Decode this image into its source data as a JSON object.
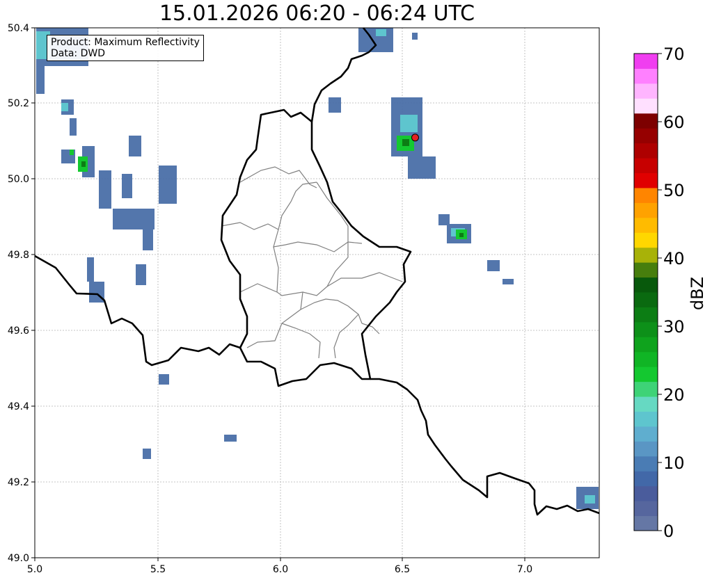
{
  "title": "15.01.2026 06:20 - 06:24 UTC",
  "info": {
    "product_line": "Product: Maximum Reflectivity",
    "data_line": "Data: DWD"
  },
  "map": {
    "lon_range": [
      5.0,
      7.3
    ],
    "lat_range": [
      49.0,
      50.4
    ],
    "x_ticks": [
      "5.0",
      "5.5",
      "6.0",
      "6.5",
      "7.0"
    ],
    "y_ticks": [
      "49.0",
      "49.2",
      "49.4",
      "49.6",
      "49.8",
      "50.0",
      "50.2",
      "50.4"
    ],
    "grid": true,
    "marker": {
      "lon": 6.55,
      "lat": 50.11,
      "color": "#e32020"
    }
  },
  "colorbar": {
    "label": "dBZ",
    "range": [
      0,
      70
    ],
    "tick_labels": [
      "0",
      "10",
      "20",
      "30",
      "40",
      "50",
      "60",
      "70"
    ],
    "colors": [
      "#6577a5",
      "#56669e",
      "#4a5c9c",
      "#4268a8",
      "#4a7cb4",
      "#5a96c4",
      "#5faecf",
      "#5ec5ce",
      "#66d9c2",
      "#3ed377",
      "#14c830",
      "#10b525",
      "#0fa31d",
      "#0d9019",
      "#0c7d14",
      "#0a6a10",
      "#08590c",
      "#477e0d",
      "#a8b208",
      "#ffd700",
      "#ffbb00",
      "#ffa200",
      "#ff8500",
      "#e00000",
      "#c70000",
      "#ae0000",
      "#960000",
      "#7d0000",
      "#ffe0ff",
      "#ffb5ff",
      "#ff80ff",
      "#f03ef0"
    ]
  }
}
